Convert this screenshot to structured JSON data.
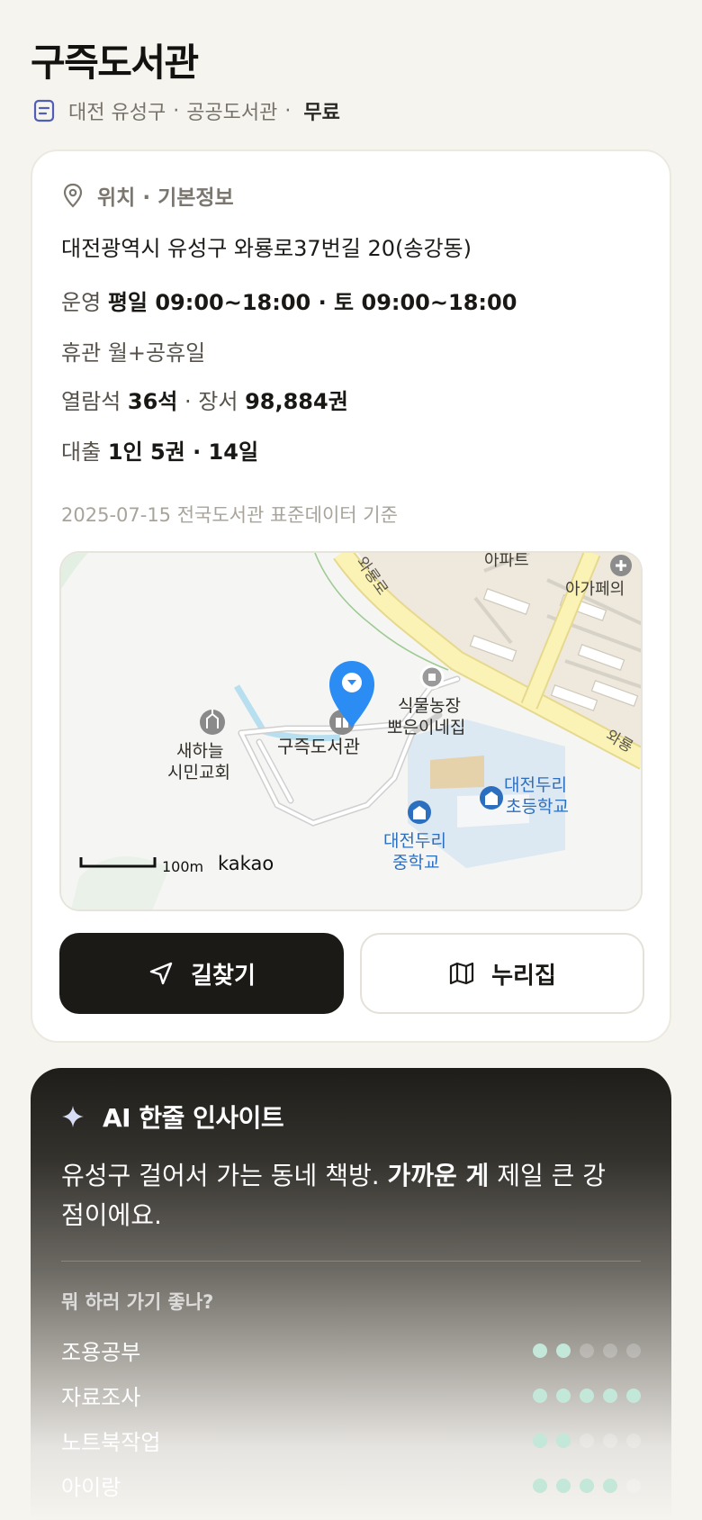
{
  "library": {
    "name": "구즉도서관",
    "meta": [
      "대전 유성구",
      "공공도서관"
    ],
    "fee": "무료"
  },
  "info": {
    "section_title": "위치 · 기본정보",
    "address": "대전광역시 유성구 와룡로37번길 20(송강동)",
    "hours_label": "운영",
    "hours_value": "평일 09:00~18:00 · 토 09:00~18:00",
    "closed_label": "휴관",
    "closed_value": "월+공휴일",
    "seats_label": "열람석",
    "seats_value": "36석",
    "books_label": "장서",
    "books_value": "98,884권",
    "loan_label": "대출",
    "loan_value": "1인 5권 · 14일",
    "source_note": "2025-07-15 전국도서관 표준데이터 기준"
  },
  "map": {
    "labels": {
      "library": "구즉도서관",
      "church_1": "새하늘",
      "church_2": "시민교회",
      "farm_1": "식물농장",
      "farm_2": "뽀은이네집",
      "elem_1": "대전두리",
      "elem_2": "초등학교",
      "mid_1": "대전두리",
      "mid_2": "중학교",
      "apt": "아파트",
      "cafe": "아가페의",
      "road_1": "와룡로",
      "road_2": "와룡",
      "scale": "100m",
      "brand": "kakao"
    },
    "colors": {
      "marker": "#2b8cf4",
      "road": "#fbf3b5",
      "school_text": "#2d6fbf"
    }
  },
  "actions": {
    "directions": "길찾기",
    "website": "누리집"
  },
  "insight": {
    "title": "AI 한줄 인사이트",
    "text_before": "유성구 걸어서 가는 동네 책방. ",
    "text_bold": "가까운 게",
    "text_after": " 제일 큰 강점이에요.",
    "question": "뭐 하러 가기 좋나?",
    "activities": [
      {
        "name": "조용공부",
        "score": 2,
        "max": 5
      },
      {
        "name": "자료조사",
        "score": 5,
        "max": 5
      },
      {
        "name": "노트북작업",
        "score": 2,
        "max": 5
      },
      {
        "name": "아이랑",
        "score": 4,
        "max": 5
      }
    ]
  }
}
